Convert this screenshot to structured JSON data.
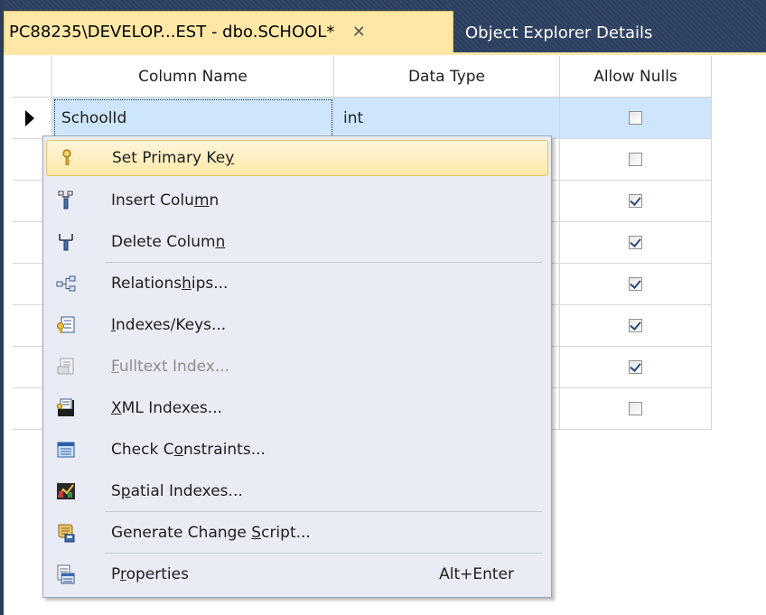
{
  "tabs": {
    "active_label": "PC88235\\DEVELOP...EST - dbo.SCHOOL*",
    "close_glyph": "✕",
    "inactive_label": "Object Explorer Details"
  },
  "grid": {
    "headers": {
      "column_name": "Column Name",
      "data_type": "Data Type",
      "allow_nulls": "Allow Nulls"
    },
    "rows": [
      {
        "name": "SchoolId",
        "type": "int",
        "allow_nulls": false,
        "selected": true
      },
      {
        "name": "",
        "type": "",
        "allow_nulls": false
      },
      {
        "name": "",
        "type": "",
        "allow_nulls": true
      },
      {
        "name": "",
        "type": "",
        "allow_nulls": true
      },
      {
        "name": "",
        "type": "",
        "allow_nulls": true
      },
      {
        "name": "",
        "type": "",
        "allow_nulls": true
      },
      {
        "name": "",
        "type": "",
        "allow_nulls": true
      },
      {
        "name": "",
        "type": "",
        "allow_nulls": false
      }
    ]
  },
  "context_menu": {
    "items": [
      {
        "label_pre": "Set Primary Ke",
        "label_key": "y",
        "label_post": "",
        "icon": "key-icon",
        "state": "highlighted"
      },
      {
        "label_pre": "Insert Colu",
        "label_key": "m",
        "label_post": "n",
        "icon": "insert-column-icon"
      },
      {
        "label_pre": "Delete Colum",
        "label_key": "n",
        "label_post": "",
        "icon": "delete-column-icon"
      },
      {
        "label_pre": "Relations",
        "label_key": "h",
        "label_post": "ips...",
        "icon": "relationships-icon"
      },
      {
        "label_pre": "",
        "label_key": "I",
        "label_post": "ndexes/Keys...",
        "icon": "indexes-keys-icon"
      },
      {
        "label_pre": "",
        "label_key": "F",
        "label_post": "ulltext Index...",
        "icon": "fulltext-index-icon",
        "state": "disabled"
      },
      {
        "label_pre": "",
        "label_key": "X",
        "label_post": "ML Indexes...",
        "icon": "xml-indexes-icon"
      },
      {
        "label_pre": "Check C",
        "label_key": "o",
        "label_post": "nstraints...",
        "icon": "check-constraints-icon"
      },
      {
        "label_pre": "S",
        "label_key": "p",
        "label_post": "atial Indexes...",
        "icon": "spatial-indexes-icon"
      },
      {
        "label_pre": "Generate Change ",
        "label_key": "S",
        "label_post": "cript...",
        "icon": "generate-script-icon"
      },
      {
        "label_pre": "P",
        "label_key": "r",
        "label_post": "operties",
        "shortcut": "Alt+Enter",
        "icon": "properties-icon"
      }
    ]
  }
}
